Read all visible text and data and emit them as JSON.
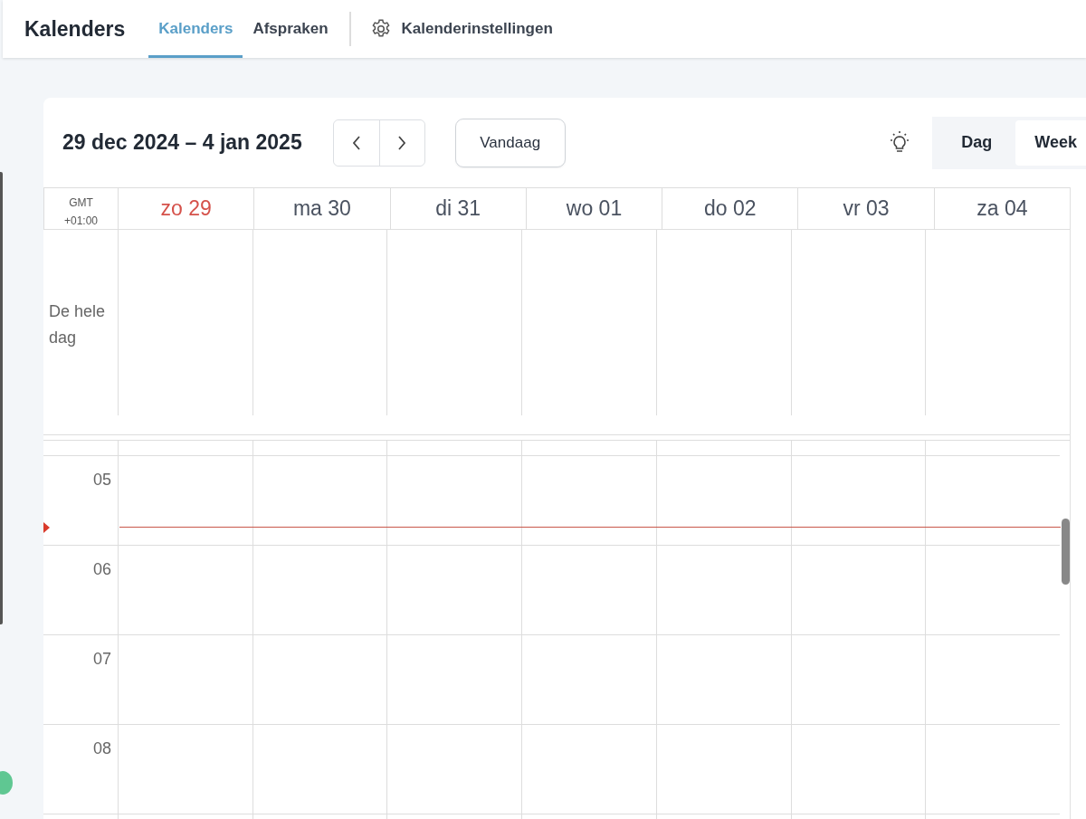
{
  "header": {
    "title": "Kalenders",
    "tabs": [
      {
        "label": "Kalenders",
        "selected": true
      },
      {
        "label": "Afspraken",
        "selected": false
      }
    ],
    "settings_link": "Kalenderinstellingen"
  },
  "toolbar": {
    "range": "29 dec 2024 – 4 jan 2025",
    "today_button": "Vandaag",
    "views": [
      {
        "label": "Dag",
        "selected": false
      },
      {
        "label": "Week",
        "selected": true
      }
    ]
  },
  "calendar": {
    "timezone": "GMT +01:00",
    "days": [
      {
        "label": "zo 29",
        "today": true
      },
      {
        "label": "ma 30",
        "today": false
      },
      {
        "label": "di 31",
        "today": false
      },
      {
        "label": "wo 01",
        "today": false
      },
      {
        "label": "do 02",
        "today": false
      },
      {
        "label": "vr 03",
        "today": false
      },
      {
        "label": "za 04",
        "today": false
      }
    ],
    "all_day_label": "De hele dag",
    "hours": [
      "05",
      "06",
      "07",
      "08"
    ]
  }
}
